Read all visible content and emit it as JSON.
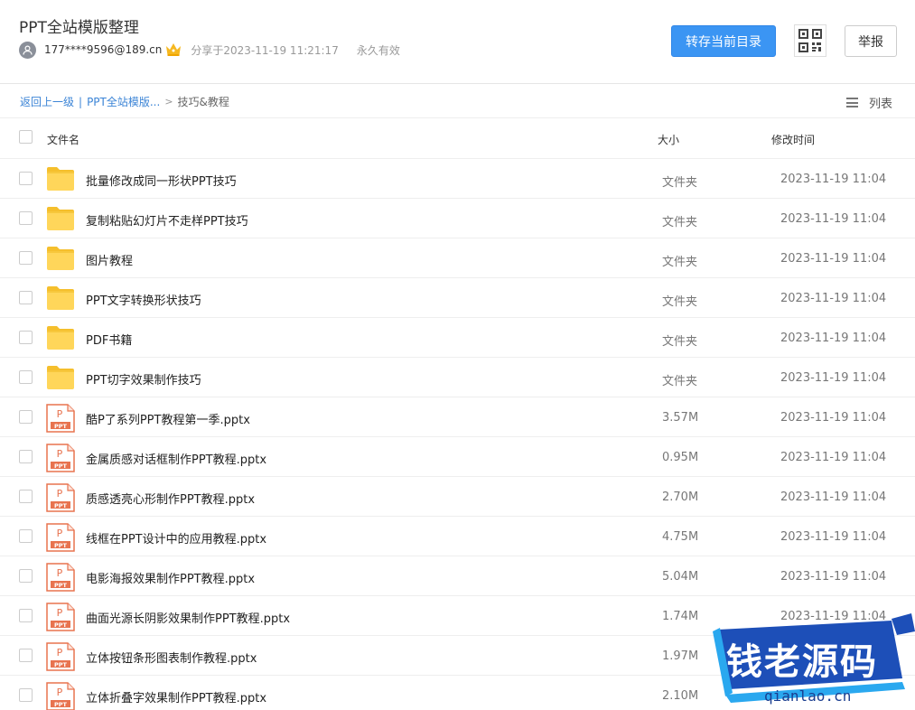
{
  "header": {
    "title": "PPT全站模版整理",
    "user": "177****9596@189.cn",
    "share_time": "分享于2023-11-19 11:21:17",
    "validity": "永久有效",
    "save_button": "转存当前目录",
    "report_button": "举报",
    "accent_color": "#3b95f3"
  },
  "breadcrumb": {
    "back": "返回上一级",
    "separator": "|",
    "parent": "PPT全站模版...",
    "arrow": ">",
    "current": "技巧&教程"
  },
  "view_toggle": {
    "label": "列表",
    "icon": "list-icon"
  },
  "table": {
    "headers": {
      "name": "文件名",
      "size": "大小",
      "time": "修改时间"
    },
    "rows": [
      {
        "type": "folder",
        "name": "批量修改成同一形状PPT技巧",
        "size": "文件夹",
        "time": "2023-11-19 11:04"
      },
      {
        "type": "folder",
        "name": "复制粘贴幻灯片不走样PPT技巧",
        "size": "文件夹",
        "time": "2023-11-19 11:04"
      },
      {
        "type": "folder",
        "name": "图片教程",
        "size": "文件夹",
        "time": "2023-11-19 11:04"
      },
      {
        "type": "folder",
        "name": "PPT文字转换形状技巧",
        "size": "文件夹",
        "time": "2023-11-19 11:04"
      },
      {
        "type": "folder",
        "name": "PDF书籍",
        "size": "文件夹",
        "time": "2023-11-19 11:04"
      },
      {
        "type": "folder",
        "name": "PPT切字效果制作技巧",
        "size": "文件夹",
        "time": "2023-11-19 11:04"
      },
      {
        "type": "ppt",
        "name": "酷P了系列PPT教程第一季.pptx",
        "size": "3.57M",
        "time": "2023-11-19 11:04"
      },
      {
        "type": "ppt",
        "name": "金属质感对话框制作PPT教程.pptx",
        "size": "0.95M",
        "time": "2023-11-19 11:04"
      },
      {
        "type": "ppt",
        "name": "质感透亮心形制作PPT教程.pptx",
        "size": "2.70M",
        "time": "2023-11-19 11:04"
      },
      {
        "type": "ppt",
        "name": "线框在PPT设计中的应用教程.pptx",
        "size": "4.75M",
        "time": "2023-11-19 11:04"
      },
      {
        "type": "ppt",
        "name": "电影海报效果制作PPT教程.pptx",
        "size": "5.04M",
        "time": "2023-11-19 11:04"
      },
      {
        "type": "ppt",
        "name": "曲面光源长阴影效果制作PPT教程.pptx",
        "size": "1.74M",
        "time": "2023-11-19 11:04"
      },
      {
        "type": "ppt",
        "name": "立体按钮条形图表制作教程.pptx",
        "size": "1.97M",
        "time": ""
      },
      {
        "type": "ppt",
        "name": "立体折叠字效果制作PPT教程.pptx",
        "size": "2.10M",
        "time": ""
      }
    ]
  },
  "ppt_icon_label": "PPT",
  "watermark": {
    "text": "钱老源码",
    "url": "qianlao.cn"
  }
}
